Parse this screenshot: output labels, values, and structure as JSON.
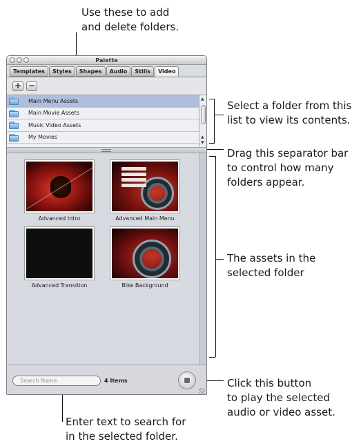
{
  "callouts": {
    "add_delete": [
      "Use these to add",
      "and delete folders."
    ],
    "select_folder": [
      "Select a folder from this",
      "list to view its contents."
    ],
    "separator": [
      "Drag this separator bar",
      "to control how many",
      "folders appear."
    ],
    "assets": [
      "The assets in the",
      "selected folder"
    ],
    "play": [
      "Click this button",
      "to play the selected",
      "audio or video asset."
    ],
    "search": [
      "Enter text to search for",
      "in the selected folder."
    ]
  },
  "window": {
    "title": "Palette",
    "tabs": [
      "Templates",
      "Styles",
      "Shapes",
      "Audio",
      "Stills",
      "Video"
    ],
    "active_tab": "Video",
    "add_glyph": "+",
    "delete_glyph": "−"
  },
  "folders": [
    {
      "label": "Main Menu Assets",
      "selected": true
    },
    {
      "label": "Main Movie Assets",
      "selected": false
    },
    {
      "label": "Music Video Assets",
      "selected": false
    },
    {
      "label": "My Movies",
      "selected": false
    }
  ],
  "assets": [
    {
      "label": "Advanced Intro",
      "style": "red-art"
    },
    {
      "label": "Advanced Main Menu",
      "style": "menu-art"
    },
    {
      "label": "Advanced Transition",
      "style": "black-art"
    },
    {
      "label": "Bike Background",
      "style": "bike-art"
    }
  ],
  "footer": {
    "search_placeholder": "Search Name",
    "item_count": "4 Items"
  },
  "colors": {
    "selected_row": "#aebedc",
    "window_bg": "#d9dce2",
    "assets_bg": "#d7dae1"
  }
}
